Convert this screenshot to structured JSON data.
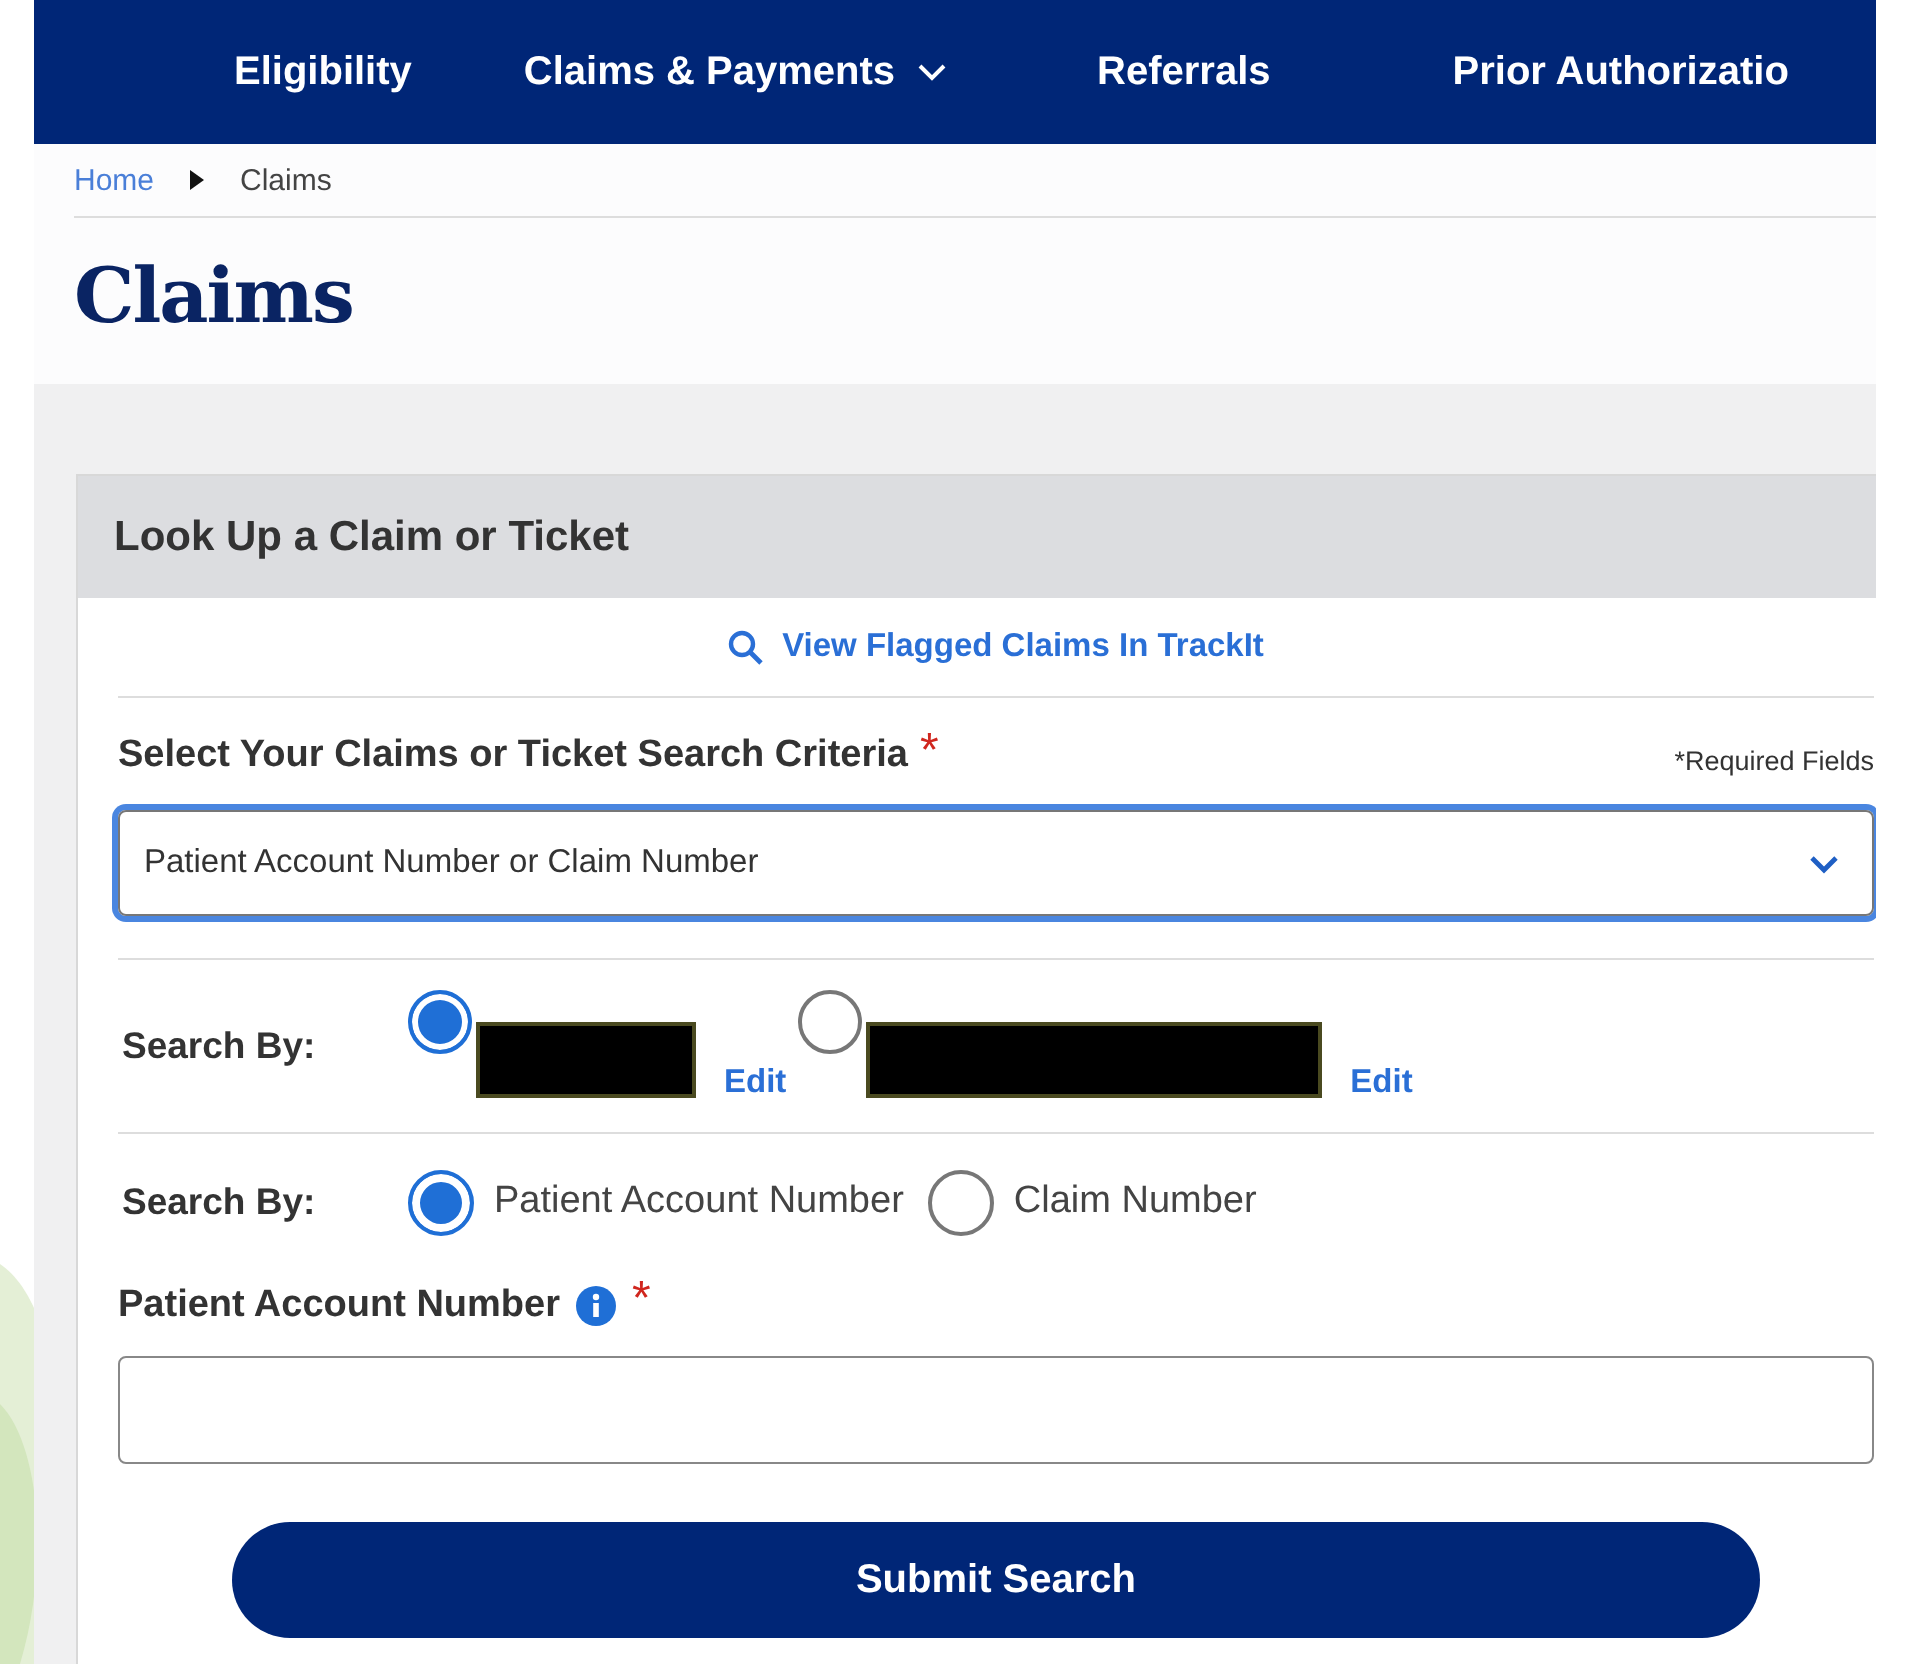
{
  "nav": {
    "items": [
      {
        "label": "Eligibility",
        "has_menu": false
      },
      {
        "label": "Claims & Payments",
        "has_menu": true
      },
      {
        "label": "Referrals",
        "has_menu": false
      },
      {
        "label": "Prior Authorizatio",
        "has_menu": false
      }
    ]
  },
  "breadcrumb": {
    "items": [
      "Home",
      "Claims"
    ]
  },
  "page_title": "Claims",
  "card": {
    "title": "Look Up a Claim or Ticket",
    "flagged_link": "View Flagged Claims In TrackIt",
    "criteria": {
      "label": "Select Your Claims or Ticket Search Criteria",
      "required_mark": "*",
      "required_note": "*Required Fields",
      "value": "Patient Account Number or Claim Number",
      "focused": true
    },
    "provider_search": {
      "label": "Search By:",
      "options": [
        {
          "kind": "redacted",
          "selected": true,
          "edit_link": "Edit"
        },
        {
          "kind": "redacted",
          "selected": false,
          "edit_link": "Edit"
        }
      ]
    },
    "id_search": {
      "label": "Search By:",
      "options": [
        {
          "label": "Patient Account Number",
          "selected": true
        },
        {
          "label": "Claim Number",
          "selected": false
        }
      ]
    },
    "account_field": {
      "label": "Patient Account Number",
      "required_mark": "*"
    },
    "submit_button": "Submit Search"
  }
}
